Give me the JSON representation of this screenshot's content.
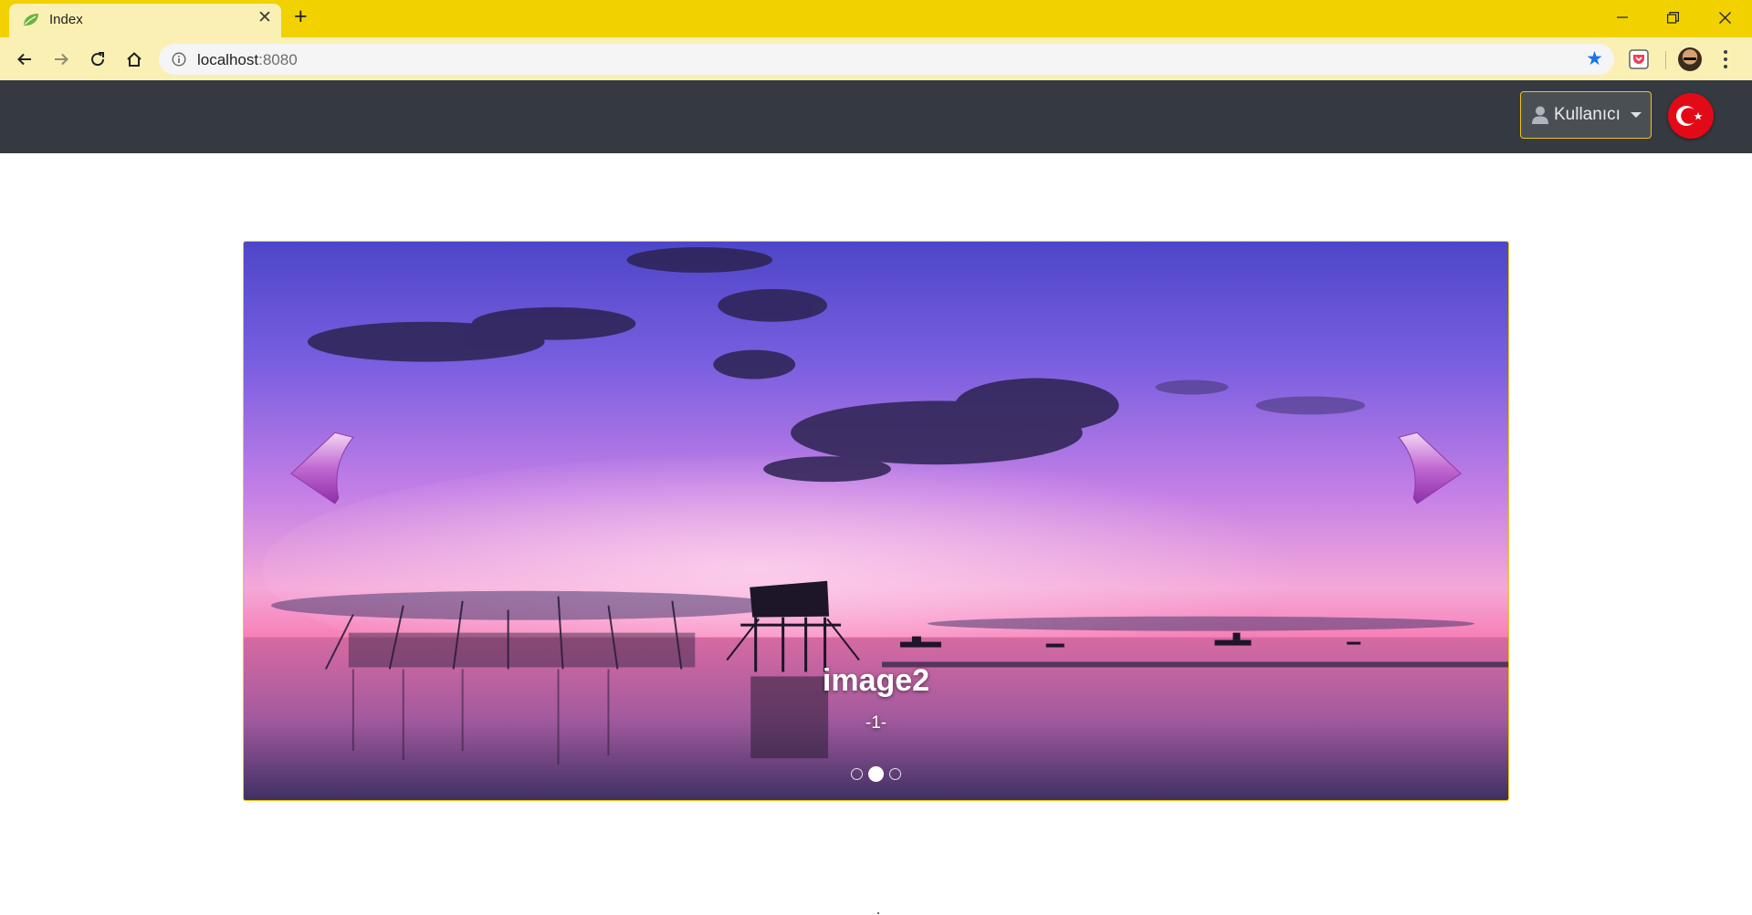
{
  "browser": {
    "tab": {
      "title": "Index",
      "favicon": "leaf-icon"
    },
    "address_bar": {
      "host": "localhost",
      "port": ":8080"
    },
    "icons": {
      "back": "arrow-left-icon",
      "forward": "arrow-right-icon",
      "reload": "reload-icon",
      "home": "home-icon",
      "info": "info-icon",
      "bookmark": "star-icon",
      "extension": "pocket-icon",
      "profile": "avatar",
      "menu": "menu-dots-icon"
    },
    "colors": {
      "tabstrip": "#f1d100",
      "toolbar": "#faf0b3"
    }
  },
  "navbar": {
    "user_menu_label": "Kullanıcı",
    "language_flag": "turkey-flag-icon",
    "colors": {
      "background": "#343a40",
      "accent": "#f1c40f"
    }
  },
  "carousel": {
    "caption_title": "image2",
    "caption_subtitle": "-1-",
    "slide_count": 3,
    "active_slide_index": 1,
    "controls": {
      "prev": "chevron-left-icon",
      "next": "chevron-right-icon"
    }
  }
}
